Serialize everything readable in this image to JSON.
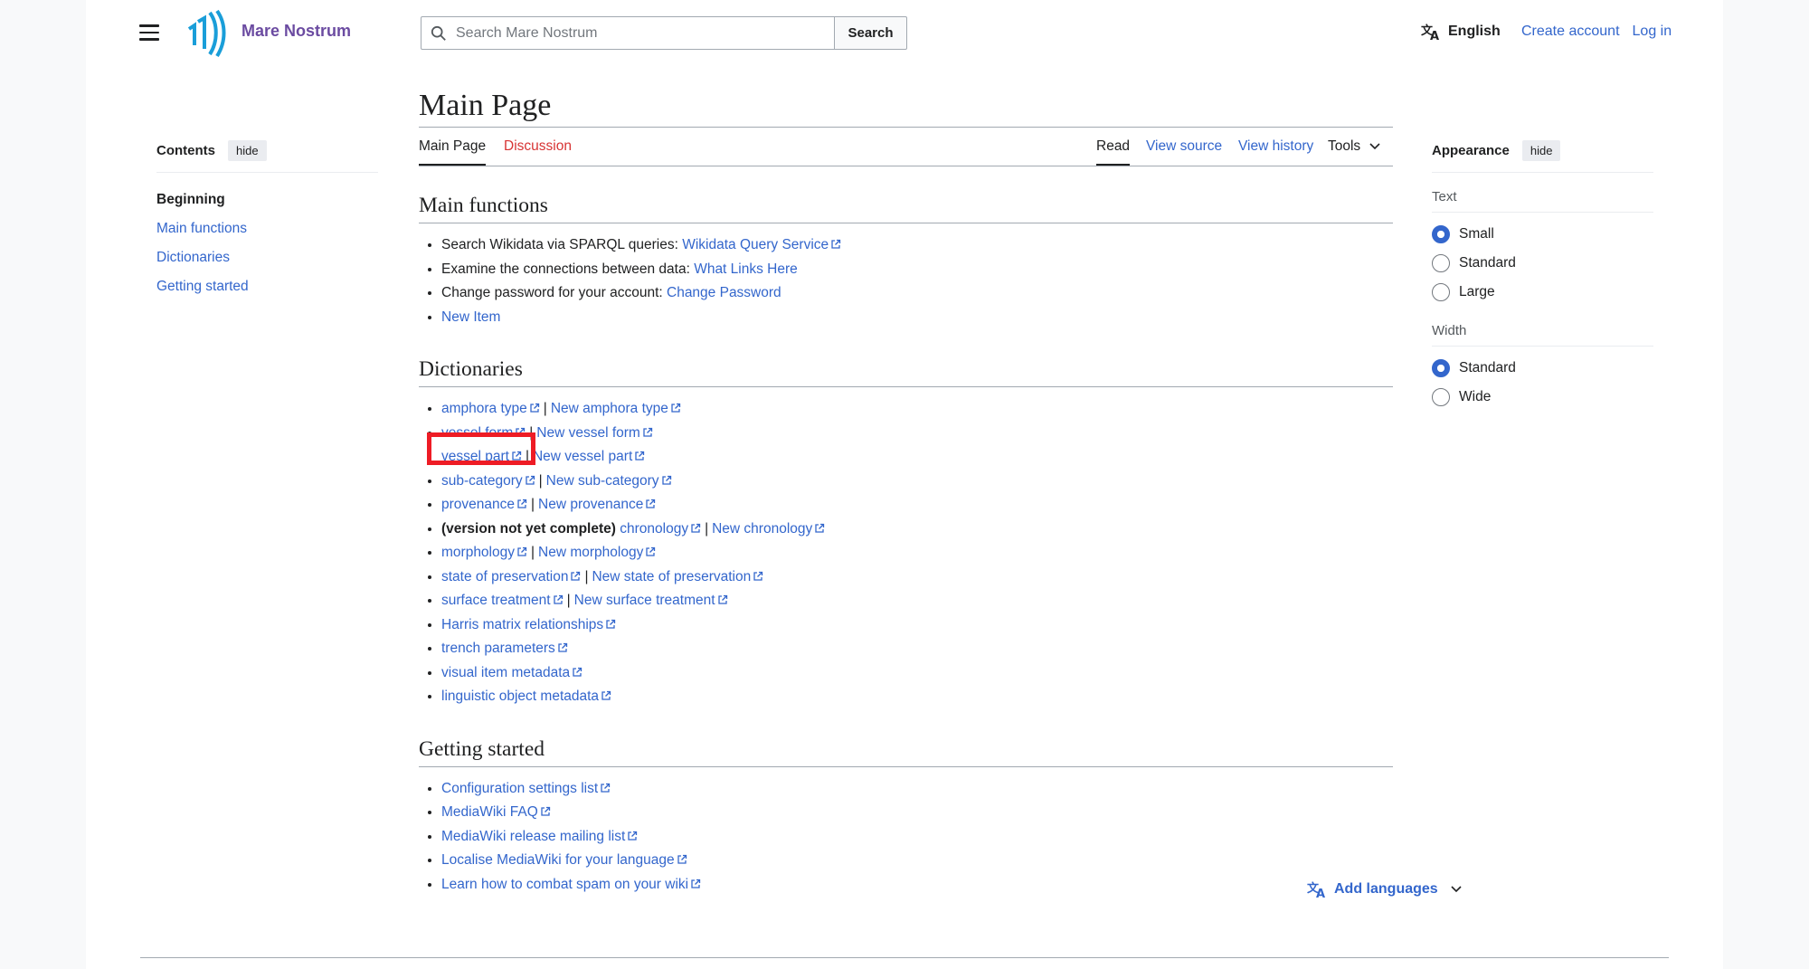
{
  "site": {
    "name": "Mare Nostrum"
  },
  "search": {
    "placeholder": "Search Mare Nostrum",
    "button": "Search"
  },
  "header": {
    "language": "English",
    "create_account": "Create account",
    "log_in": "Log in"
  },
  "toc": {
    "title": "Contents",
    "hide": "hide",
    "items": [
      "Beginning",
      "Main functions",
      "Dictionaries",
      "Getting started"
    ]
  },
  "page": {
    "title": "Main Page",
    "tabs": {
      "main": "Main Page",
      "discussion": "Discussion",
      "read": "Read",
      "view_source": "View source",
      "view_history": "View history",
      "tools": "Tools"
    }
  },
  "main_functions": {
    "heading": "Main functions",
    "items": [
      {
        "text": "Search Wikidata via SPARQL queries: ",
        "link": "Wikidata Query Service"
      },
      {
        "text": "Examine the connections between data: ",
        "link": "What Links Here"
      },
      {
        "text": "Change password for your account: ",
        "link": "Change Password"
      },
      {
        "text": "",
        "link": "New Item"
      }
    ]
  },
  "dictionaries": {
    "heading": "Dictionaries",
    "separator": "|",
    "items": [
      {
        "prefix": "",
        "a": "amphora type",
        "b": "New amphora type"
      },
      {
        "prefix": "",
        "a": "vessel form",
        "b": "New vessel form"
      },
      {
        "prefix": "",
        "a": "vessel part",
        "b": "New vessel part"
      },
      {
        "prefix": "",
        "a": "sub-category",
        "b": "New sub-category"
      },
      {
        "prefix": "",
        "a": "provenance",
        "b": "New provenance"
      },
      {
        "prefix": "(version not yet complete)",
        "a": "chronology",
        "b": "New chronology"
      },
      {
        "prefix": "",
        "a": "morphology",
        "b": "New morphology"
      },
      {
        "prefix": "",
        "a": "state of preservation",
        "b": "New state of preservation"
      },
      {
        "prefix": "",
        "a": "surface treatment",
        "b": "New surface treatment"
      },
      {
        "prefix": "",
        "a": "Harris matrix relationships",
        "b": ""
      },
      {
        "prefix": "",
        "a": "trench parameters",
        "b": ""
      },
      {
        "prefix": "",
        "a": "visual item metadata",
        "b": ""
      },
      {
        "prefix": "",
        "a": "linguistic object metadata",
        "b": ""
      }
    ]
  },
  "getting_started": {
    "heading": "Getting started",
    "items": [
      "Configuration settings list",
      "MediaWiki FAQ",
      "MediaWiki release mailing list",
      "Localise MediaWiki for your language",
      "Learn how to combat spam on your wiki"
    ]
  },
  "add_languages": "Add languages",
  "appearance": {
    "title": "Appearance",
    "hide": "hide",
    "text_label": "Text",
    "text_options": [
      "Small",
      "Standard",
      "Large"
    ],
    "text_selected": "Small",
    "width_label": "Width",
    "width_options": [
      "Standard",
      "Wide"
    ],
    "width_selected": "Standard"
  },
  "colors": {
    "link": "#3366cc",
    "red_link": "#d73333",
    "brand": "#6b4ba1",
    "logo": "#1a9ed9",
    "highlight": "#ee1c25"
  }
}
